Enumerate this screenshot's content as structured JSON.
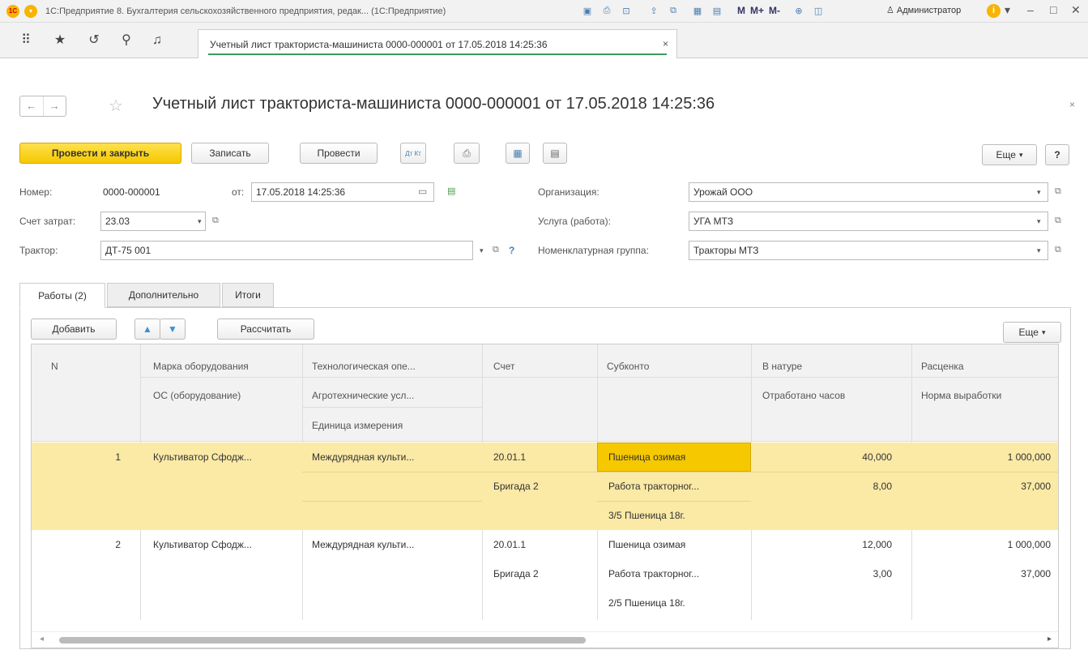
{
  "titlebar": {
    "app_title": "1С:Предприятие 8. Бухгалтерия сельскохозяйственного предприятия, редак... (1С:Предприятие)",
    "m": "M",
    "mplus": "M+",
    "mminus": "M-",
    "user": "Администратор",
    "info": "i",
    "minimize": "–",
    "maximize": "□",
    "close": "✕"
  },
  "nav": {
    "doc_tab": "Учетный лист тракториста-машиниста 0000-000001 от 17.05.2018 14:25:36",
    "doc_tab_close": "×"
  },
  "form": {
    "title": "Учетный лист тракториста-машиниста 0000-000001 от 17.05.2018 14:25:36",
    "close": "×",
    "back": "←",
    "forward": "→"
  },
  "toolbar": {
    "post_close": "Провести и закрыть",
    "save": "Записать",
    "post": "Провести",
    "dtkt": "Дт Кт",
    "more": "Еще",
    "help": "?"
  },
  "fields": {
    "number_label": "Номер:",
    "number_value": "0000-000001",
    "date_label": "от:",
    "date_value": "17.05.2018 14:25:36",
    "org_label": "Организация:",
    "org_value": "Урожай ООО",
    "cost_account_label": "Счет затрат:",
    "cost_account_value": "23.03",
    "service_label": "Услуга (работа):",
    "service_value": "УГА МТЗ",
    "tractor_label": "Трактор:",
    "tractor_value": "ДТ-75 001",
    "nomen_group_label": "Номенклатурная группа:",
    "nomen_group_value": "Тракторы МТЗ",
    "help_q": "?"
  },
  "tabs": [
    {
      "label": "Работы (2)"
    },
    {
      "label": "Дополнительно"
    },
    {
      "label": "Итоги"
    }
  ],
  "table_toolbar": {
    "add": "Добавить",
    "calc": "Рассчитать",
    "more": "Еще"
  },
  "table": {
    "headers": {
      "n": "N",
      "brand": "Марка оборудования",
      "os": "ОС (оборудование)",
      "tech_op": "Технологическая опе...",
      "agro": "Агротехнические усл...",
      "unit": "Единица измерения",
      "account": "Счет",
      "subconto": "Субконто",
      "natural": "В натуре",
      "hours": "Отработано часов",
      "rate": "Расценка",
      "norm": "Норма выработки"
    },
    "rows": [
      {
        "n": "1",
        "brand": "Культиватор Сфодж...",
        "tech_op": "Междурядная культи...",
        "account": "20.01.1",
        "account2": "Бригада 2",
        "sub1": "Пшеница озимая",
        "sub2": "Работа тракторног...",
        "sub3": "3/5 Пшеница 18г.",
        "natural": "40,000",
        "hours": "8,00",
        "rate": "1 000,000",
        "norm": "37,000"
      },
      {
        "n": "2",
        "brand": "Культиватор Сфодж...",
        "tech_op": "Междурядная культи...",
        "account": "20.01.1",
        "account2": "Бригада 2",
        "sub1": "Пшеница озимая",
        "sub2": "Работа тракторног...",
        "sub3": "2/5 Пшеница 18г.",
        "natural": "12,000",
        "hours": "3,00",
        "rate": "1 000,000",
        "norm": "37,000"
      }
    ]
  }
}
